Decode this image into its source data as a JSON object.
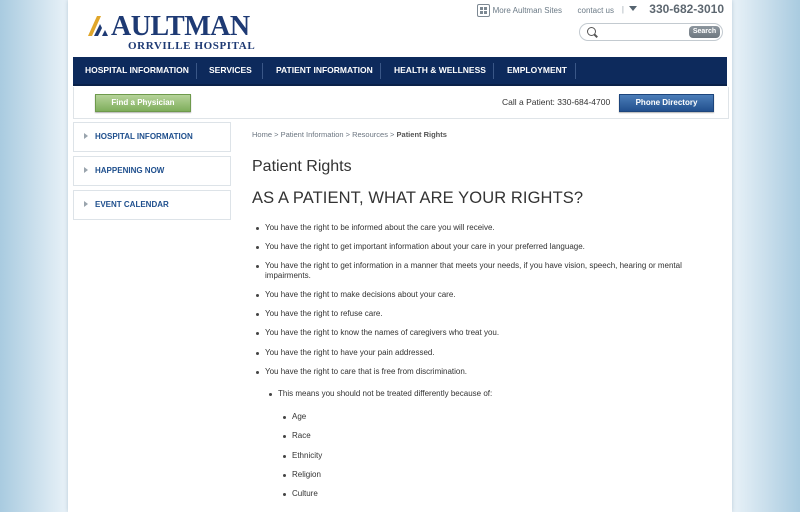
{
  "header": {
    "logo_title": "AULTMAN",
    "logo_subtitle": "ORRVILLE HOSPITAL",
    "more_sites": "More Aultman Sites",
    "contact": "contact us",
    "separator": "|",
    "phone": "330-682-3010",
    "search": {
      "placeholder": "",
      "button": "Search"
    }
  },
  "nav": {
    "items": [
      {
        "label": "HOSPITAL INFORMATION"
      },
      {
        "label": "SERVICES"
      },
      {
        "label": "PATIENT INFORMATION"
      },
      {
        "label": "HEALTH & WELLNESS"
      },
      {
        "label": "EMPLOYMENT"
      }
    ]
  },
  "action_bar": {
    "find_physician": "Find a Physician",
    "call_patient": "Call a Patient: 330-684-4700",
    "phone_directory": "Phone Directory"
  },
  "sidebar": {
    "items": [
      {
        "label": "HOSPITAL INFORMATION"
      },
      {
        "label": "HAPPENING NOW"
      },
      {
        "label": "EVENT CALENDAR"
      }
    ]
  },
  "breadcrumb": {
    "home": "Home",
    "patient_info": "Patient Information",
    "resources": "Resources",
    "separator": " > ",
    "current": "Patient Rights"
  },
  "content": {
    "page_title": "Patient Rights",
    "section_title": "AS A PATIENT, WHAT ARE YOUR RIGHTS?",
    "rights": [
      "You have the right to be informed about the care you will receive.",
      "You have the right to get important information about your care in your preferred language.",
      "You have the right to get information in a manner that meets your needs, if you have vision, speech, hearing or mental impairments.",
      "You have the right to make decisions about your care.",
      "You have the right to refuse care.",
      "You have the right to know the names of caregivers who treat you.",
      "You have the right to have your pain addressed.",
      "You have the right to care that is free from discrimination."
    ],
    "discrimination_intro": "This means you should not be treated differently because of:",
    "discrimination_items": [
      "Age",
      "Race",
      "Ethnicity",
      "Religion",
      "Culture"
    ]
  },
  "colors": {
    "nav_bg": "#0d2a5c",
    "brand_blue": "#1e3a74",
    "accent_gold": "#e0a62a",
    "link_blue": "#1f4f8d",
    "green_button": "#7fae5c"
  }
}
